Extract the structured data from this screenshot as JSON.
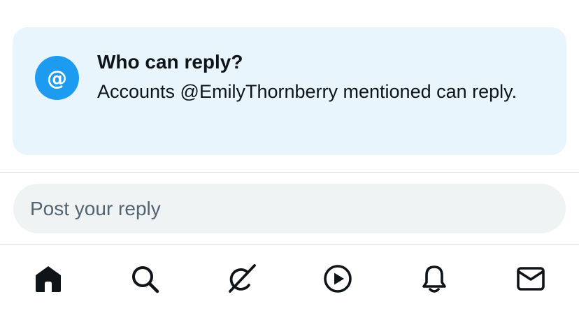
{
  "reply_card": {
    "icon": "at-sign-icon",
    "icon_glyph": "@",
    "title": "Who can reply?",
    "description": "Accounts @EmilyThornberry mentioned can reply."
  },
  "reply_box": {
    "placeholder": "Post your reply"
  },
  "bottom_nav": {
    "items": [
      {
        "icon": "home-icon",
        "active": true
      },
      {
        "icon": "search-icon",
        "active": false
      },
      {
        "icon": "grok-icon",
        "active": false
      },
      {
        "icon": "video-icon",
        "active": false
      },
      {
        "icon": "notifications-bell-icon",
        "active": false
      },
      {
        "icon": "messages-envelope-icon",
        "active": false
      }
    ]
  },
  "colors": {
    "accent": "#1d9bf0",
    "card_background": "#e8f5fd",
    "input_background": "#eff3f4",
    "text": "#0f1419",
    "placeholder": "#536471"
  }
}
